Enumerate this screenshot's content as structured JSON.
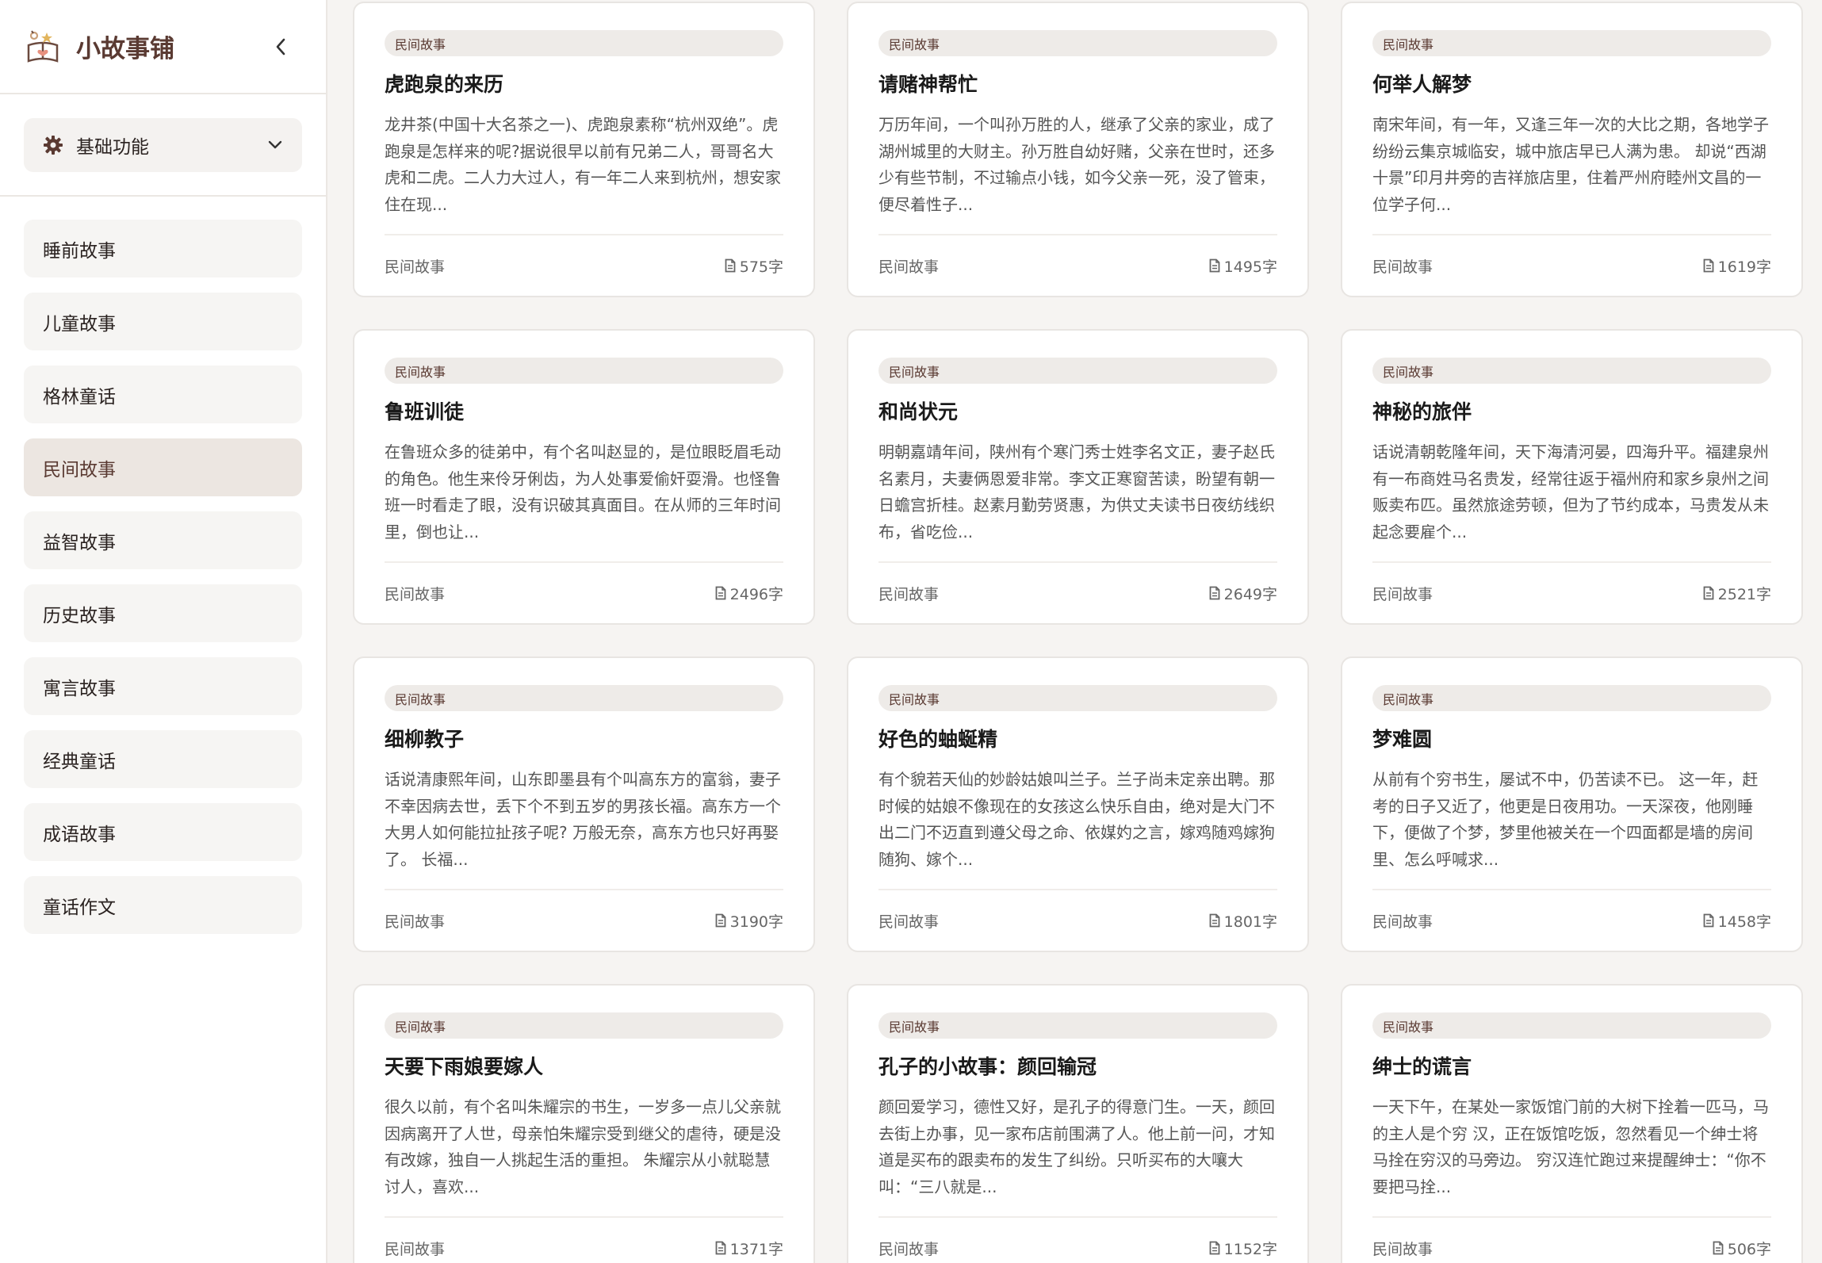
{
  "brand": {
    "title": "小故事铺",
    "logo_icon": "storybook-logo-icon"
  },
  "function_select": {
    "label": "基础功能"
  },
  "menu": [
    {
      "label": "睡前故事",
      "active": false
    },
    {
      "label": "儿童故事",
      "active": false
    },
    {
      "label": "格林童话",
      "active": false
    },
    {
      "label": "民间故事",
      "active": true
    },
    {
      "label": "益智故事",
      "active": false
    },
    {
      "label": "历史故事",
      "active": false
    },
    {
      "label": "寓言故事",
      "active": false
    },
    {
      "label": "经典童话",
      "active": false
    },
    {
      "label": "成语故事",
      "active": false
    },
    {
      "label": "童话作文",
      "active": false
    }
  ],
  "cards": [
    {
      "tag": "民间故事",
      "title": "虎跑泉的来历",
      "excerpt": "龙井茶(中国十大名茶之一)、虎跑泉素称“杭州双绝”。虎跑泉是怎样来的呢?据说很早以前有兄弟二人，哥哥名大虎和二虎。二人力大过人，有一年二人来到杭州，想安家住在现...",
      "category": "民间故事",
      "count": "575字"
    },
    {
      "tag": "民间故事",
      "title": "请赌神帮忙",
      "excerpt": "万历年间，一个叫孙万胜的人，继承了父亲的家业，成了湖州城里的大财主。孙万胜自幼好赌，父亲在世时，还多少有些节制，不过输点小钱，如今父亲一死，没了管束，便尽着性子...",
      "category": "民间故事",
      "count": "1495字"
    },
    {
      "tag": "民间故事",
      "title": "何举人解梦",
      "excerpt": "南宋年间，有一年，又逢三年一次的大比之期，各地学子纷纷云集京城临安，城中旅店早已人满为患。 却说“西湖十景”印月井旁的吉祥旅店里，住着严州府睦州文昌的一位学子何...",
      "category": "民间故事",
      "count": "1619字"
    },
    {
      "tag": "民间故事",
      "title": "鲁班训徒",
      "excerpt": "在鲁班众多的徒弟中，有个名叫赵显的，是位眼眨眉毛动的角色。他生来伶牙俐齿，为人处事爱偷奸耍滑。也怪鲁班一时看走了眼，没有识破其真面目。在从师的三年时间里，倒也让...",
      "category": "民间故事",
      "count": "2496字"
    },
    {
      "tag": "民间故事",
      "title": "和尚状元",
      "excerpt": "明朝嘉靖年间，陕州有个寒门秀士姓李名文正，妻子赵氏名素月，夫妻俩恩爱非常。李文正寒窗苦读，盼望有朝一日蟾宫折桂。赵素月勤劳贤惠，为供丈夫读书日夜纺线织布，省吃俭...",
      "category": "民间故事",
      "count": "2649字"
    },
    {
      "tag": "民间故事",
      "title": "神秘的旅伴",
      "excerpt": "话说清朝乾隆年间，天下海清河晏，四海升平。福建泉州有一布商姓马名贵发，经常往返于福州府和家乡泉州之间贩卖布匹。虽然旅途劳顿，但为了节约成本，马贵发从未起念要雇个...",
      "category": "民间故事",
      "count": "2521字"
    },
    {
      "tag": "民间故事",
      "title": "细柳教子",
      "excerpt": "话说清康熙年间，山东即墨县有个叫高东方的富翁，妻子不幸因病去世，丢下个不到五岁的男孩长福。高东方一个大男人如何能拉扯孩子呢? 万般无奈，高东方也只好再娶了。 长福...",
      "category": "民间故事",
      "count": "3190字"
    },
    {
      "tag": "民间故事",
      "title": "好色的蚰蜒精",
      "excerpt": "有个貌若天仙的妙龄姑娘叫兰子。兰子尚未定亲出聘。那时候的姑娘不像现在的女孩这么快乐自由，绝对是大门不出二门不迈直到遵父母之命、依媒妁之言，嫁鸡随鸡嫁狗随狗、嫁个...",
      "category": "民间故事",
      "count": "1801字"
    },
    {
      "tag": "民间故事",
      "title": "梦难圆",
      "excerpt": "从前有个穷书生，屡试不中，仍苦读不已。 这一年，赶考的日子又近了，他更是日夜用功。一天深夜，他刚睡下，便做了个梦，梦里他被关在一个四面都是墙的房间里、怎么呼喊求...",
      "category": "民间故事",
      "count": "1458字"
    },
    {
      "tag": "民间故事",
      "title": "天要下雨娘要嫁人",
      "excerpt": "很久以前，有个名叫朱耀宗的书生，一岁多一点儿父亲就因病离开了人世，母亲怕朱耀宗受到继父的虐待，硬是没有改嫁，独自一人挑起生活的重担。 朱耀宗从小就聪慧讨人，喜欢...",
      "category": "民间故事",
      "count": "1371字"
    },
    {
      "tag": "民间故事",
      "title": "孔子的小故事：颜回输冠",
      "excerpt": "颜回爱学习，德性又好，是孔子的得意门生。一天，颜回去街上办事，见一家布店前围满了人。他上前一问，才知道是买布的跟卖布的发生了纠纷。只听买布的大嚷大叫：“三八就是...",
      "category": "民间故事",
      "count": "1152字"
    },
    {
      "tag": "民间故事",
      "title": "绅士的谎言",
      "excerpt": "一天下午，在某处一家饭馆门前的大树下拴着一匹马，马的主人是个穷 汉，正在饭馆吃饭，忽然看见一个绅士将马拴在穷汉的马旁边。 穷汉连忙跑过来提醒绅士：“你不要把马拴...",
      "category": "民间故事",
      "count": "506字"
    }
  ]
}
